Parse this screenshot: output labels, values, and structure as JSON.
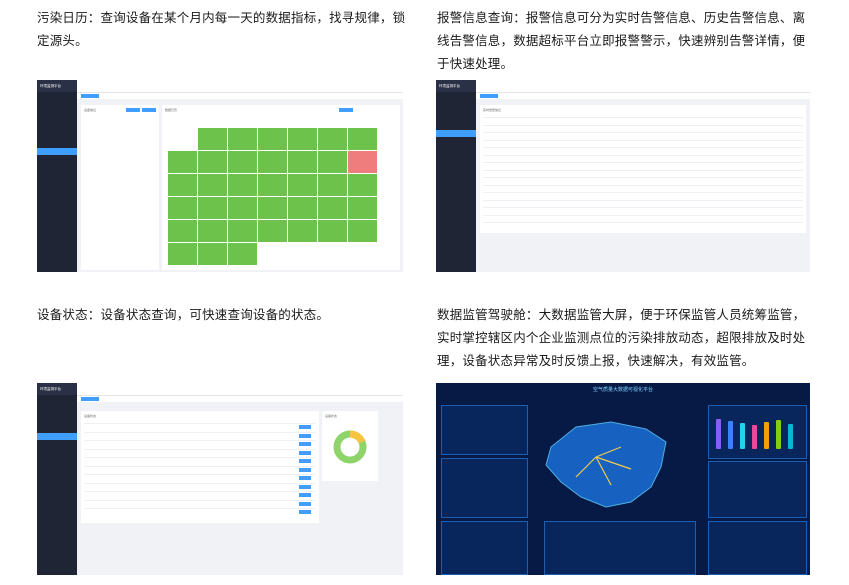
{
  "sections": [
    {
      "id": "calendar",
      "text": "污染日历：查询设备在某个月内每一天的数据指标，找寻规律，锁定源头。"
    },
    {
      "id": "alarm",
      "text": "报警信息查询：报警信息可分为实时告警信息、历史告警信息、离线告警信息，数据超标平台立即报警警示，快速辨别告警详情，便于快速处理。"
    },
    {
      "id": "status",
      "text": "设备状态：设备状态查询，可快速查询设备的状态。"
    },
    {
      "id": "cockpit",
      "text": "数据监管驾驶舱：大数据监管大屏，便于环保监管人员统筹监管，实时掌控辖区内个企业监测点位的污染排放动态，超限排放及时处理，设备状态异常及时反馈上报，快速解决，有效监管。"
    }
  ],
  "screens": {
    "calendar": {
      "app_title": "环境监测平台",
      "panel_title": "数据日历",
      "info_title": "设备信息"
    },
    "alarm": {
      "app_title": "环境监测平台",
      "panel_title": "实时告警信息"
    },
    "status": {
      "app_title": "环境监测平台",
      "panel_title": "设备状态",
      "chart_title": "设备状态"
    },
    "cockpit": {
      "title": "空气质量大数据可视化平台"
    }
  },
  "colors": {
    "accent": "#409eff",
    "ok": "#6cc24a",
    "alarm": "#ef7d7d",
    "sidebar": "#1f2535",
    "screen_bg": "#061a45"
  }
}
